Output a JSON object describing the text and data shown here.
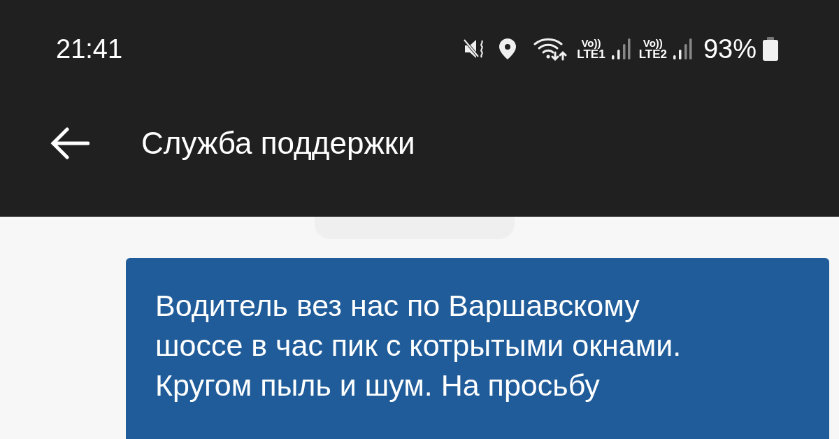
{
  "status_bar": {
    "time": "21:41",
    "sims": [
      {
        "volte": "Vo))",
        "network": "LTE1"
      },
      {
        "volte": "Vo))",
        "network": "LTE2"
      }
    ],
    "battery": "93%"
  },
  "app_bar": {
    "title": "Служба поддержки"
  },
  "messages": [
    {
      "kind": "outgoing",
      "lines": [
        "Водитель вез нас по Варшавскому",
        "шоссе в час пик с котрытыми окнами.",
        "Кругом пыль и шум. На просьбу"
      ]
    }
  ]
}
